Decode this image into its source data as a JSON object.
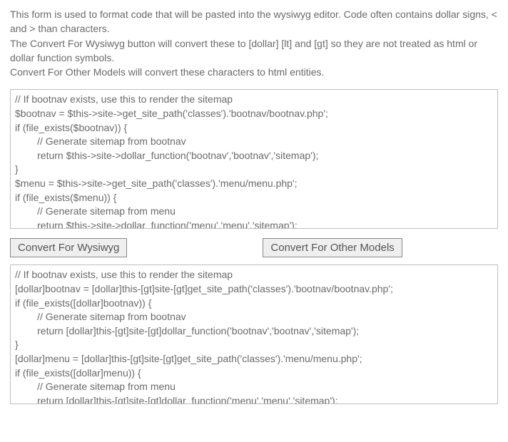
{
  "description": {
    "line1": "This form is used to format code that will be pasted into the wysiwyg editor. Code often contains dollar signs, < and > than characters.",
    "line2": "The Convert For Wysiwyg button will convert these to [dollar] [lt] and [gt] so they are not treated as html or dollar function symbols.",
    "line3": "Convert For Other Models will convert these characters to html entities."
  },
  "input_code": "// If bootnav exists, use this to render the sitemap\n$bootnav = $this->site->get_site_path('classes').'bootnav/bootnav.php';\nif (file_exists($bootnav)) {\n        // Generate sitemap from bootnav\n        return $this->site->dollar_function('bootnav','bootnav','sitemap');\n}\n$menu = $this->site->get_site_path('classes').'menu/menu.php';\nif (file_exists($menu)) {\n        // Generate sitemap from menu\n        return $this->site->dollar_function('menu','menu','sitemap');\n}",
  "output_code": "// If bootnav exists, use this to render the sitemap\n[dollar]bootnav = [dollar]this-[gt]site-[gt]get_site_path('classes').'bootnav/bootnav.php';\nif (file_exists([dollar]bootnav)) {\n        // Generate sitemap from bootnav\n        return [dollar]this-[gt]site-[gt]dollar_function('bootnav','bootnav','sitemap');\n}\n[dollar]menu = [dollar]this-[gt]site-[gt]get_site_path('classes').'menu/menu.php';\nif (file_exists([dollar]menu)) {\n        // Generate sitemap from menu\n        return [dollar]this-[gt]site-[gt]dollar_function('menu','menu','sitemap');\n}",
  "buttons": {
    "wysiwyg": "Convert For Wysiwyg",
    "other": "Convert For Other Models"
  }
}
